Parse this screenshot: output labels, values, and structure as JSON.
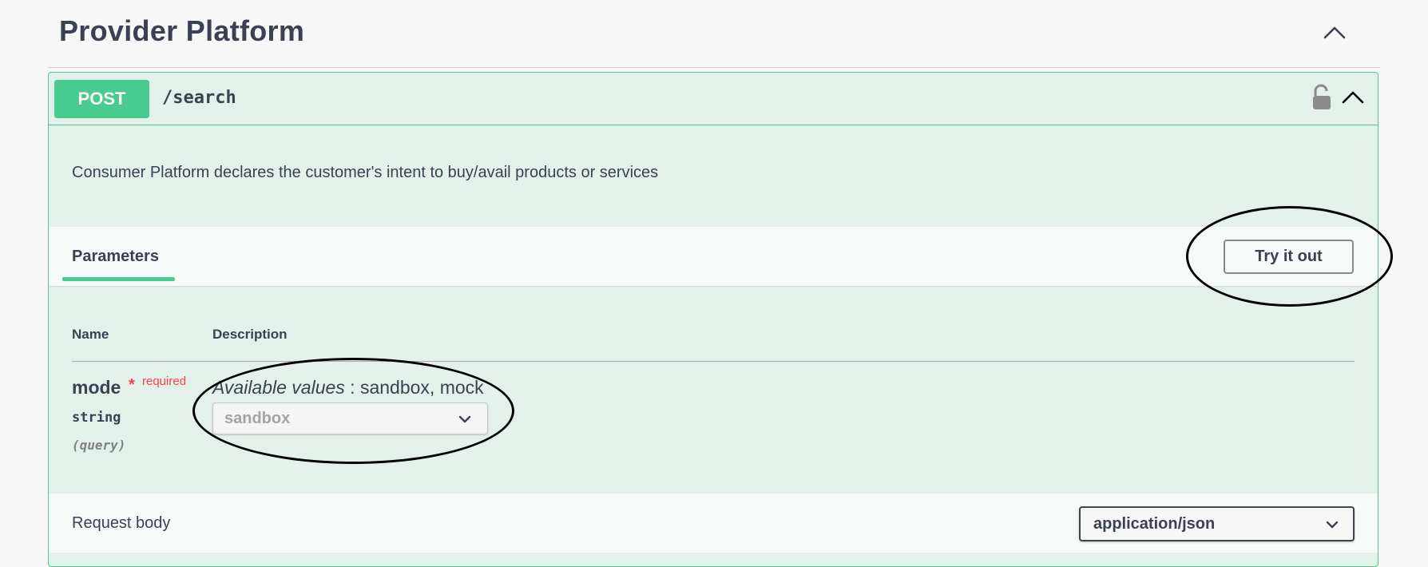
{
  "section": {
    "title": "Provider Platform"
  },
  "operation": {
    "method": "POST",
    "path": "/search",
    "description": "Consumer Platform declares the customer's intent to buy/avail products or services",
    "tabs": {
      "parameters_label": "Parameters",
      "try_it_out_label": "Try it out"
    },
    "parameters_table": {
      "headers": [
        "Name",
        "Description"
      ],
      "rows": [
        {
          "name": "mode",
          "required_marker": "*",
          "required_label": "required",
          "type": "string",
          "in": "(query)",
          "available_values_label": "Available values",
          "available_values_text": " : sandbox, mock",
          "selected_value": "sandbox"
        }
      ]
    },
    "request_body": {
      "label": "Request body",
      "content_type": "application/json"
    }
  },
  "colors": {
    "post_accent": "#49cc90",
    "post_background": "#e3f1ea",
    "required_red": "#ff3f3f",
    "text_primary": "#3b4151"
  },
  "icons": [
    "chevron-up-icon",
    "lock-icon",
    "chevron-down-icon"
  ]
}
